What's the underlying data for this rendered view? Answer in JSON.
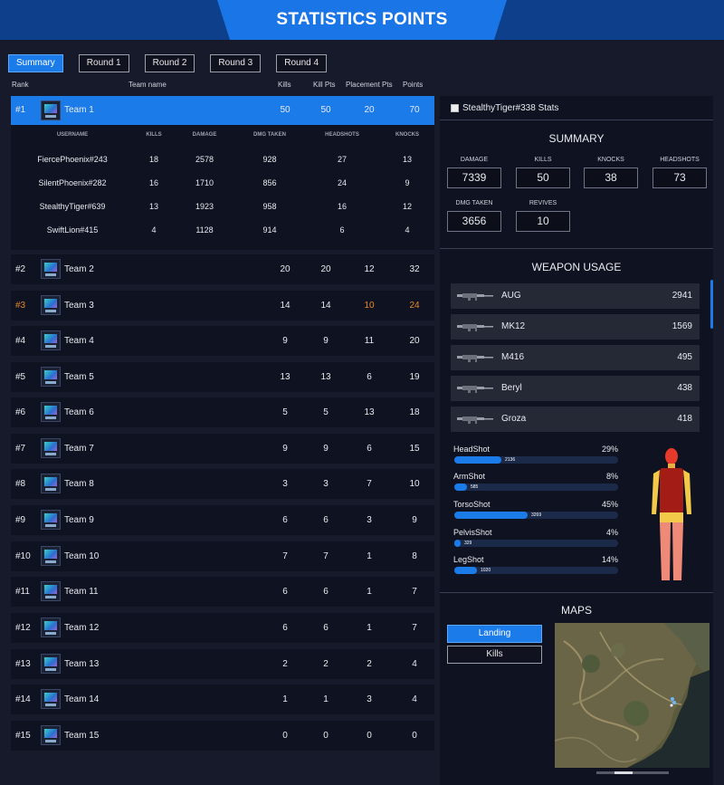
{
  "header": {
    "title": "STATISTICS POINTS"
  },
  "tabs": [
    {
      "label": "Summary",
      "active": true
    },
    {
      "label": "Round 1",
      "active": false
    },
    {
      "label": "Round 2",
      "active": false
    },
    {
      "label": "Round 3",
      "active": false
    },
    {
      "label": "Round 4",
      "active": false
    }
  ],
  "table_headers": {
    "rank": "Rank",
    "team_name": "Team name",
    "kills": "Kills",
    "kill_pts": "Kill Pts",
    "placement_pts": "Placement Pts",
    "points": "Points"
  },
  "teams": [
    {
      "rank": "#1",
      "name": "Team 1",
      "kills": "50",
      "kill_pts": "50",
      "placement_pts": "20",
      "points": "70"
    },
    {
      "rank": "#2",
      "name": "Team 2",
      "kills": "20",
      "kill_pts": "20",
      "placement_pts": "12",
      "points": "32"
    },
    {
      "rank": "#3",
      "name": "Team 3",
      "kills": "14",
      "kill_pts": "14",
      "placement_pts": "10",
      "points": "24"
    },
    {
      "rank": "#4",
      "name": "Team 4",
      "kills": "9",
      "kill_pts": "9",
      "placement_pts": "11",
      "points": "20"
    },
    {
      "rank": "#5",
      "name": "Team 5",
      "kills": "13",
      "kill_pts": "13",
      "placement_pts": "6",
      "points": "19"
    },
    {
      "rank": "#6",
      "name": "Team 6",
      "kills": "5",
      "kill_pts": "5",
      "placement_pts": "13",
      "points": "18"
    },
    {
      "rank": "#7",
      "name": "Team 7",
      "kills": "9",
      "kill_pts": "9",
      "placement_pts": "6",
      "points": "15"
    },
    {
      "rank": "#8",
      "name": "Team 8",
      "kills": "3",
      "kill_pts": "3",
      "placement_pts": "7",
      "points": "10"
    },
    {
      "rank": "#9",
      "name": "Team 9",
      "kills": "6",
      "kill_pts": "6",
      "placement_pts": "3",
      "points": "9"
    },
    {
      "rank": "#10",
      "name": "Team 10",
      "kills": "7",
      "kill_pts": "7",
      "placement_pts": "1",
      "points": "8"
    },
    {
      "rank": "#11",
      "name": "Team 11",
      "kills": "6",
      "kill_pts": "6",
      "placement_pts": "1",
      "points": "7"
    },
    {
      "rank": "#12",
      "name": "Team 12",
      "kills": "6",
      "kill_pts": "6",
      "placement_pts": "1",
      "points": "7"
    },
    {
      "rank": "#13",
      "name": "Team 13",
      "kills": "2",
      "kill_pts": "2",
      "placement_pts": "2",
      "points": "4"
    },
    {
      "rank": "#14",
      "name": "Team 14",
      "kills": "1",
      "kill_pts": "1",
      "placement_pts": "3",
      "points": "4"
    },
    {
      "rank": "#15",
      "name": "Team 15",
      "kills": "0",
      "kill_pts": "0",
      "placement_pts": "0",
      "points": "0"
    }
  ],
  "player_table": {
    "headers": {
      "username": "USERNAME",
      "kills": "KILLS",
      "damage": "DAMAGE",
      "dmg_taken": "DMG TAKEN",
      "headshots": "HEADSHOTS",
      "knocks": "KNOCKS"
    },
    "rows": [
      {
        "username": "FiercePhoenix#243",
        "kills": "18",
        "damage": "2578",
        "dmg_taken": "928",
        "headshots": "27",
        "knocks": "13"
      },
      {
        "username": "SilentPhoenix#282",
        "kills": "16",
        "damage": "1710",
        "dmg_taken": "856",
        "headshots": "24",
        "knocks": "9"
      },
      {
        "username": "StealthyTiger#639",
        "kills": "13",
        "damage": "1923",
        "dmg_taken": "958",
        "headshots": "16",
        "knocks": "12"
      },
      {
        "username": "SwiftLion#415",
        "kills": "4",
        "damage": "1128",
        "dmg_taken": "914",
        "headshots": "6",
        "knocks": "4"
      }
    ]
  },
  "player_stats": {
    "title": "StealthyTiger#338 Stats",
    "summary_title": "SUMMARY",
    "stats": [
      {
        "label": "DAMAGE",
        "value": "7339"
      },
      {
        "label": "KILLS",
        "value": "50"
      },
      {
        "label": "KNOCKS",
        "value": "38"
      },
      {
        "label": "HEADSHOTS",
        "value": "73"
      },
      {
        "label": "DMG TAKEN",
        "value": "3656"
      },
      {
        "label": "REVIVES",
        "value": "10"
      }
    ]
  },
  "weapon_usage": {
    "title": "WEAPON USAGE",
    "weapons": [
      {
        "name": "AUG",
        "value": "2941"
      },
      {
        "name": "MK12",
        "value": "1569"
      },
      {
        "name": "M416",
        "value": "495"
      },
      {
        "name": "Beryl",
        "value": "438"
      },
      {
        "name": "Groza",
        "value": "418"
      }
    ]
  },
  "hit_distribution": [
    {
      "label": "HeadShot",
      "percent": "29%",
      "value": "2136",
      "fraction": 0.29
    },
    {
      "label": "ArmShot",
      "percent": "8%",
      "value": "585",
      "fraction": 0.08
    },
    {
      "label": "TorsoShot",
      "percent": "45%",
      "value": "3269",
      "fraction": 0.45
    },
    {
      "label": "PelvisShot",
      "percent": "4%",
      "value": "329",
      "fraction": 0.04
    },
    {
      "label": "LegShot",
      "percent": "14%",
      "value": "1020",
      "fraction": 0.14
    }
  ],
  "maps": {
    "title": "MAPS",
    "buttons": [
      {
        "label": "Landing",
        "active": true
      },
      {
        "label": "Kills",
        "active": false
      }
    ],
    "carousel_active": 1
  },
  "colors": {
    "accent": "#1b7be8",
    "third_place": "#e8892b",
    "header_bar": "#0d3f8a"
  }
}
